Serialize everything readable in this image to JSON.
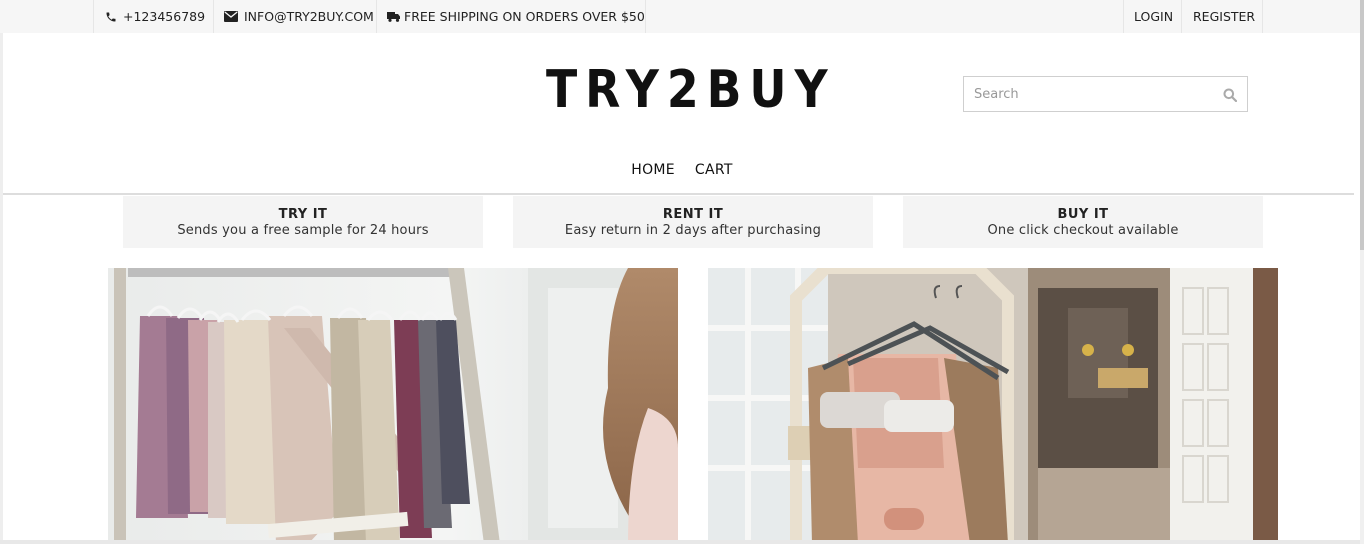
{
  "topbar": {
    "phone": "+123456789",
    "email": "INFO@TRY2BUY.COM",
    "shipping": "FREE SHIPPING ON ORDERS OVER $50",
    "login": "LOGIN",
    "register": "REGISTER",
    "icons": {
      "phone": "phone-icon",
      "email": "envelope-icon",
      "shipping": "truck-icon"
    }
  },
  "header": {
    "logo": "TRY2BUY",
    "search": {
      "placeholder": "Search",
      "value": "",
      "icon": "search-icon"
    }
  },
  "nav": {
    "items": [
      {
        "label": "HOME"
      },
      {
        "label": "CART"
      }
    ]
  },
  "features": [
    {
      "title": "TRY IT",
      "desc": "Sends you a free sample for 24 hours"
    },
    {
      "title": "RENT IT",
      "desc": "Easy return in 2 days after purchasing"
    },
    {
      "title": "BUY IT",
      "desc": "One click checkout available"
    }
  ],
  "images": [
    {
      "subject": "dresses-on-clothing-rack"
    },
    {
      "subject": "dress-on-display-stand-in-boutique"
    }
  ],
  "colors": {
    "topbar_bg": "#f6f6f6",
    "feature_bg": "#f4f4f4",
    "text": "#111111"
  }
}
